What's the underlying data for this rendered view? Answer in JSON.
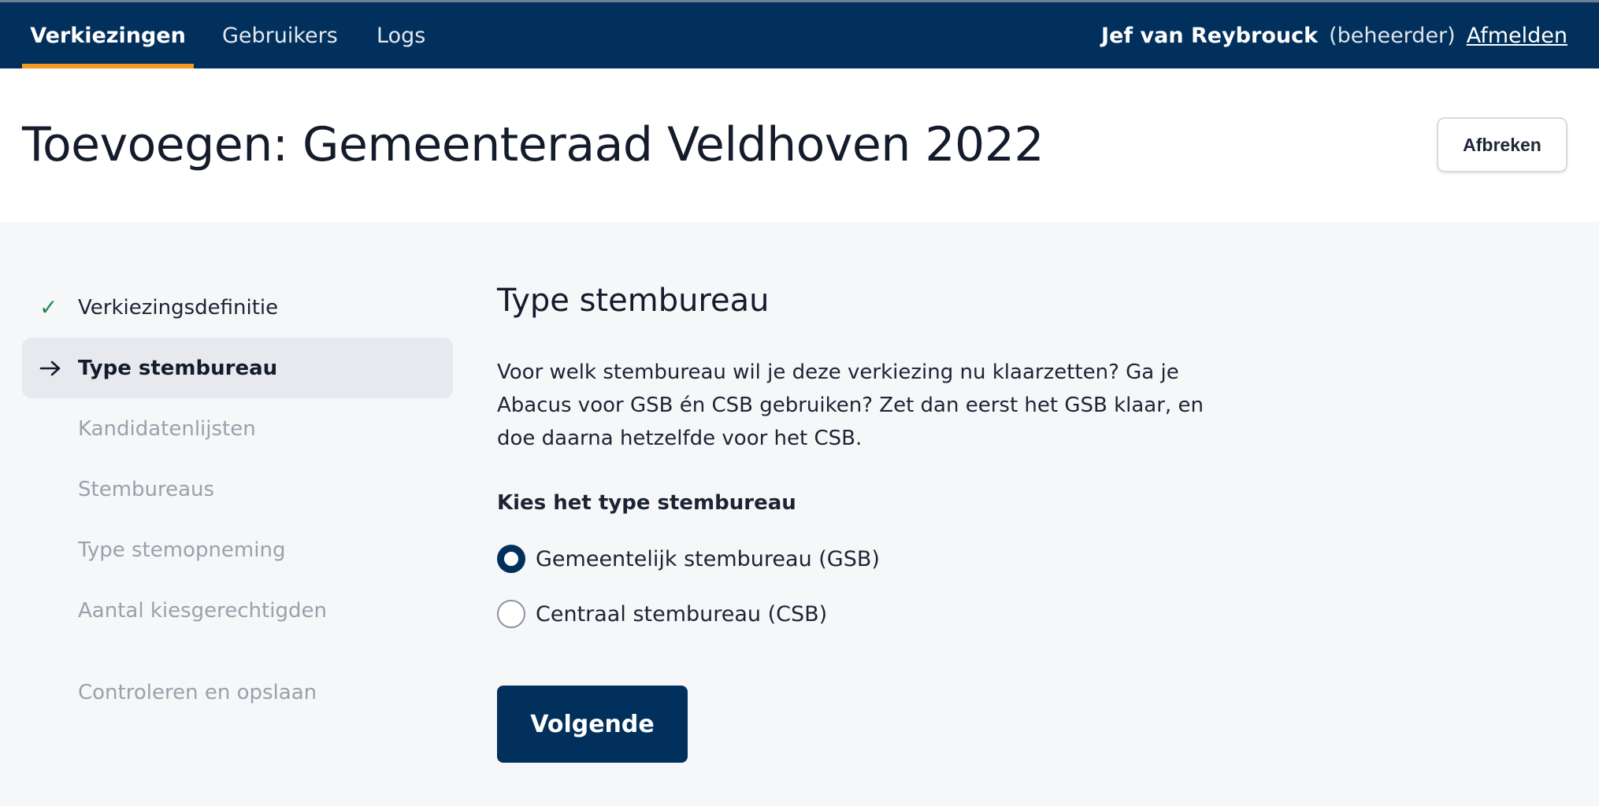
{
  "nav": {
    "items": [
      {
        "label": "Verkiezingen",
        "active": true
      },
      {
        "label": "Gebruikers",
        "active": false
      },
      {
        "label": "Logs",
        "active": false
      }
    ],
    "user_name": "Jef van Reybrouck",
    "user_role": "(beheerder)",
    "logout_label": "Afmelden"
  },
  "header": {
    "title": "Toevoegen: Gemeenteraad Veldhoven 2022",
    "cancel_label": "Afbreken"
  },
  "steps": [
    {
      "label": "Verkiezingsdefinitie",
      "state": "done",
      "icon": "check-icon"
    },
    {
      "label": "Type stembureau",
      "state": "current",
      "icon": "arrow-right-icon"
    },
    {
      "label": "Kandidatenlijsten",
      "state": "upcoming"
    },
    {
      "label": "Stembureaus",
      "state": "upcoming"
    },
    {
      "label": "Type stemopneming",
      "state": "upcoming"
    },
    {
      "label": "Aantal kiesgerechtigden",
      "state": "upcoming"
    },
    {
      "label": "Controleren en opslaan",
      "state": "upcoming"
    }
  ],
  "main": {
    "title": "Type stembureau",
    "intro": "Voor welk stembureau wil je deze verkiezing nu klaarzetten? Ga je Abacus voor GSB én CSB gebruiken? Zet dan eerst het GSB klaar, en doe daarna hetzelfde voor het CSB.",
    "field_label": "Kies het type stembureau",
    "options": [
      {
        "label": "Gemeentelijk stembureau (GSB)",
        "selected": true
      },
      {
        "label": "Centraal stembureau (CSB)",
        "selected": false
      }
    ],
    "next_label": "Volgende"
  },
  "colors": {
    "nav_bg": "#01305c",
    "nav_active_underline": "#f39b1f",
    "check": "#1f8a4c",
    "primary_button": "#01305c"
  }
}
